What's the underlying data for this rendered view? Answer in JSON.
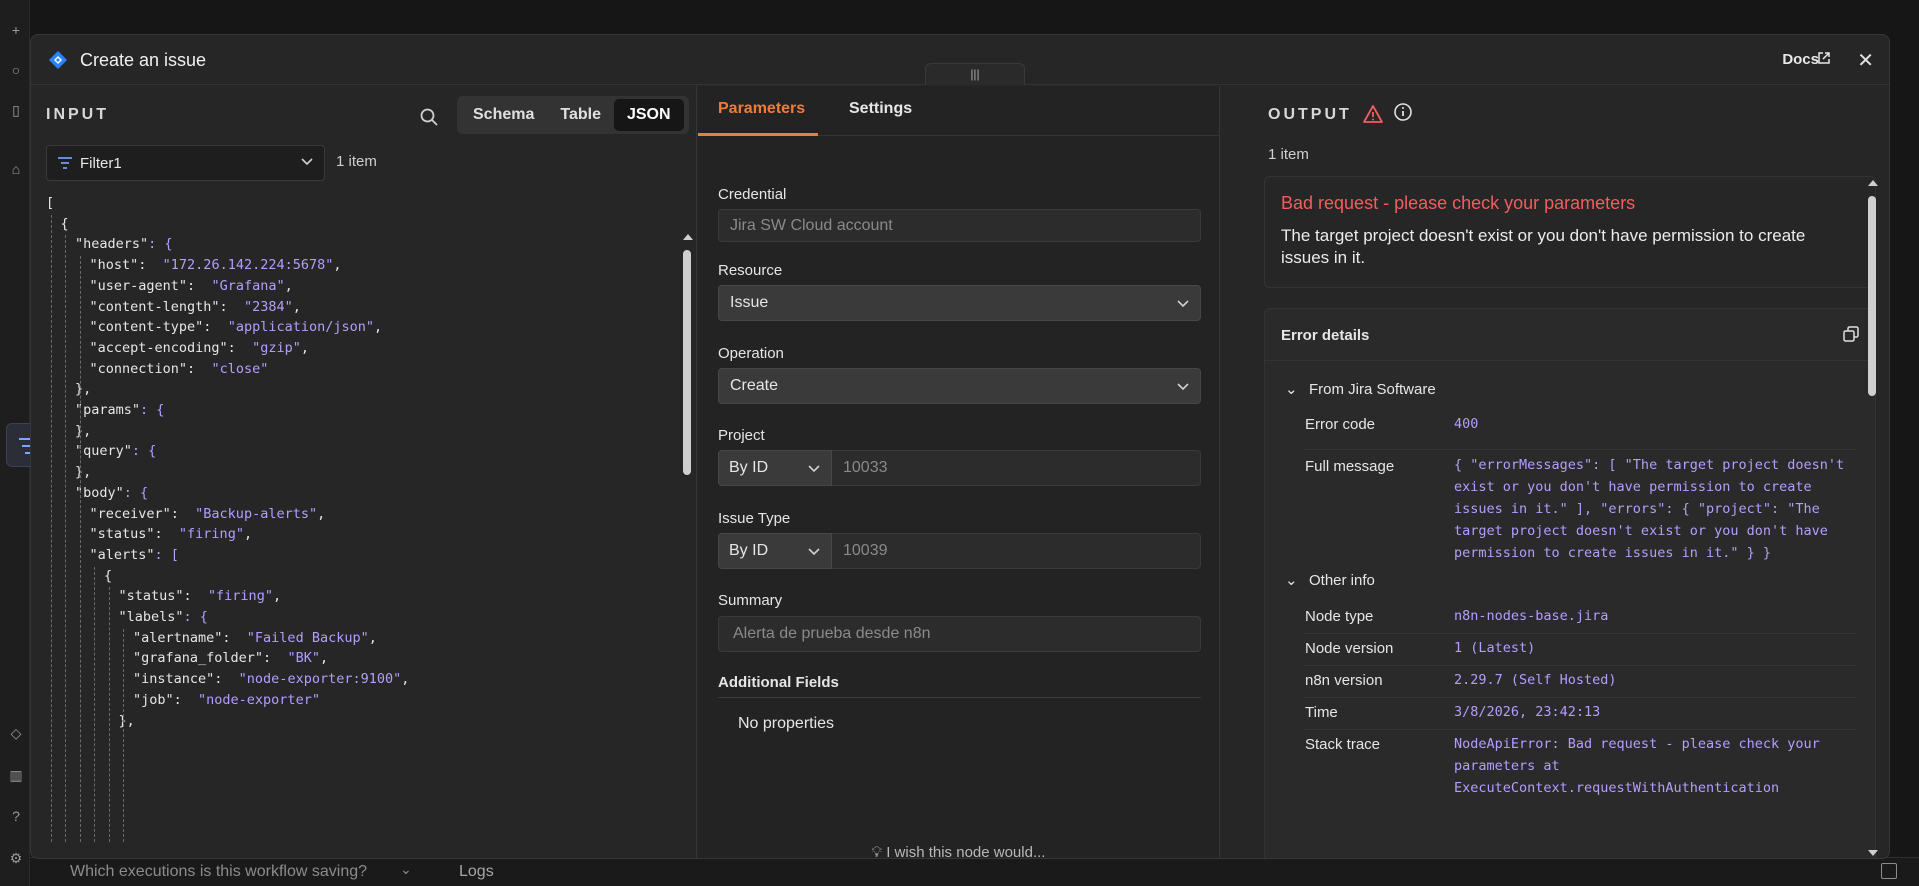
{
  "modal": {
    "title": "Create an issue",
    "docs_label": "Docs",
    "handle_glyph": "|||"
  },
  "input": {
    "label": "INPUT",
    "view_tabs": [
      "Schema",
      "Table",
      "JSON"
    ],
    "active_view": "JSON",
    "node_selector": "Filter1",
    "item_count": "1 item",
    "json_lines": [
      {
        "indent": 0,
        "key": "",
        "value": "",
        "punct": "["
      },
      {
        "indent": 1,
        "key": "",
        "value": "",
        "punct": "{"
      },
      {
        "indent": 2,
        "key": "\"headers\"",
        "value": "",
        "punct": ": {"
      },
      {
        "indent": 3,
        "key": "\"host\"",
        "value": "\"172.26.142.224:5678\"",
        "punct": ","
      },
      {
        "indent": 3,
        "key": "\"user-agent\"",
        "value": "\"Grafana\"",
        "punct": ","
      },
      {
        "indent": 3,
        "key": "\"content-length\"",
        "value": "\"2384\"",
        "punct": ","
      },
      {
        "indent": 3,
        "key": "\"content-type\"",
        "value": "\"application/json\"",
        "punct": ","
      },
      {
        "indent": 3,
        "key": "\"accept-encoding\"",
        "value": "\"gzip\"",
        "punct": ","
      },
      {
        "indent": 3,
        "key": "\"connection\"",
        "value": "\"close\"",
        "punct": ""
      },
      {
        "indent": 2,
        "key": "",
        "value": "",
        "punct": "},"
      },
      {
        "indent": 2,
        "key": "\"params\"",
        "value": "",
        "punct": ": {"
      },
      {
        "indent": 2,
        "key": "",
        "value": "",
        "punct": "},"
      },
      {
        "indent": 2,
        "key": "\"query\"",
        "value": "",
        "punct": ": {"
      },
      {
        "indent": 2,
        "key": "",
        "value": "",
        "punct": "},"
      },
      {
        "indent": 2,
        "key": "\"body\"",
        "value": "",
        "punct": ": {"
      },
      {
        "indent": 3,
        "key": "\"receiver\"",
        "value": "\"Backup-alerts\"",
        "punct": ","
      },
      {
        "indent": 3,
        "key": "\"status\"",
        "value": "\"firing\"",
        "punct": ","
      },
      {
        "indent": 3,
        "key": "\"alerts\"",
        "value": "",
        "punct": ": ["
      },
      {
        "indent": 4,
        "key": "",
        "value": "",
        "punct": "{"
      },
      {
        "indent": 5,
        "key": "\"status\"",
        "value": "\"firing\"",
        "punct": ","
      },
      {
        "indent": 5,
        "key": "\"labels\"",
        "value": "",
        "punct": ": {"
      },
      {
        "indent": 6,
        "key": "\"alertname\"",
        "value": "\"Failed Backup\"",
        "punct": ","
      },
      {
        "indent": 6,
        "key": "\"grafana_folder\"",
        "value": "\"BK\"",
        "punct": ","
      },
      {
        "indent": 6,
        "key": "\"instance\"",
        "value": "\"node-exporter:9100\"",
        "punct": ","
      },
      {
        "indent": 6,
        "key": "\"job\"",
        "value": "\"node-exporter\"",
        "punct": ""
      },
      {
        "indent": 5,
        "key": "",
        "value": "",
        "punct": "},"
      }
    ]
  },
  "params": {
    "tabs": [
      "Parameters",
      "Settings"
    ],
    "active_tab": "Parameters",
    "credential_label": "Credential",
    "credential_value": "Jira SW Cloud account",
    "resource_label": "Resource",
    "resource_value": "Issue",
    "operation_label": "Operation",
    "operation_value": "Create",
    "project_label": "Project",
    "project_mode": "By ID",
    "project_value": "10033",
    "issue_type_label": "Issue Type",
    "issue_type_mode": "By ID",
    "issue_type_value": "10039",
    "summary_label": "Summary",
    "summary_value": "Alerta de prueba desde n8n",
    "additional_fields_label": "Additional Fields",
    "no_properties": "No properties",
    "wish_text": "I wish this node would..."
  },
  "output": {
    "label": "OUTPUT",
    "item_count": "1 item",
    "error_title": "Bad request - please check your parameters",
    "error_description": "The target project doesn't exist or you don't have permission to create issues in it.",
    "details_title": "Error details",
    "section_from": "From Jira Software",
    "section_other": "Other info",
    "rows_from": [
      {
        "key": "Error code",
        "value": "400"
      },
      {
        "key": "Full message",
        "value": "{ \"errorMessages\": [ \"The target project doesn't exist or you don't have permission to create issues in it.\" ], \"errors\": { \"project\": \"The target project doesn't exist or you don't have permission to create issues in it.\" } }"
      }
    ],
    "rows_other": [
      {
        "key": "Node type",
        "value": "n8n-nodes-base.jira"
      },
      {
        "key": "Node version",
        "value": "1 (Latest)"
      },
      {
        "key": "n8n version",
        "value": "2.29.7 (Self Hosted)"
      },
      {
        "key": "Time",
        "value": "3/8/2026, 23:42:13"
      },
      {
        "key": "Stack trace",
        "value": "NodeApiError: Bad request - please check your parameters at ExecuteContext.requestWithAuthentication"
      }
    ]
  },
  "bottom_bar": {
    "executions_question": "Which executions is this workflow saving?",
    "logs_label": "Logs"
  },
  "colors": {
    "accent": "#ef7d3a",
    "error": "#f35d5d",
    "json_value": "#b49dff",
    "jira_blue": "#2684ff"
  }
}
